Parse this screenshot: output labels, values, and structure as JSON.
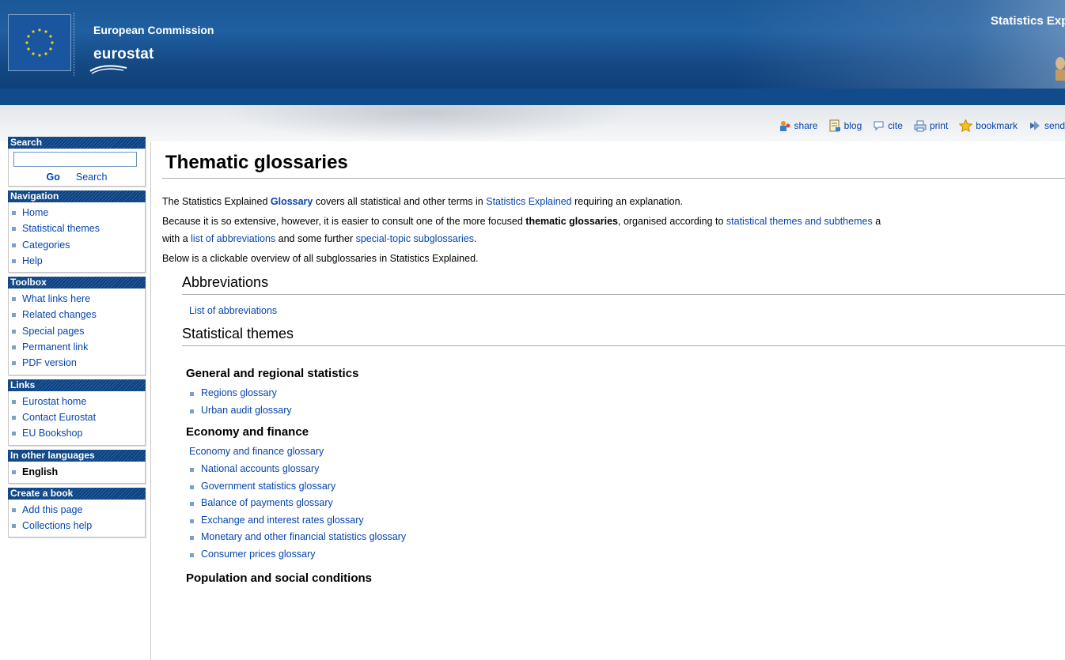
{
  "header": {
    "org_name": "European Commission",
    "logo_text": "eurostat",
    "site_title": "Statistics Explained"
  },
  "share_toolbar": [
    {
      "icon": "share-icon",
      "label": "share"
    },
    {
      "icon": "blog-icon",
      "label": "blog"
    },
    {
      "icon": "cite-icon",
      "label": "cite"
    },
    {
      "icon": "print-icon",
      "label": "print"
    },
    {
      "icon": "bookmark-star-icon",
      "label": "bookmark"
    },
    {
      "icon": "send-icon",
      "label": "send"
    }
  ],
  "sidebar": {
    "search": {
      "title": "Search",
      "input_value": "",
      "go_label": "Go",
      "search_label": "Search"
    },
    "navigation": {
      "title": "Navigation",
      "items": [
        "Home",
        "Statistical themes",
        "Categories",
        "Help"
      ]
    },
    "toolbox": {
      "title": "Toolbox",
      "items": [
        "What links here",
        "Related changes",
        "Special pages",
        "Permanent link",
        "PDF version"
      ]
    },
    "links": {
      "title": "Links",
      "items": [
        "Eurostat home",
        "Contact Eurostat",
        "EU Bookshop"
      ]
    },
    "languages": {
      "title": "In other languages",
      "items": [
        "English"
      ]
    },
    "book": {
      "title": "Create a book",
      "items": [
        "Add this page",
        "Collections help"
      ]
    }
  },
  "main": {
    "page_title": "Thematic glossaries",
    "intro1": {
      "before": "The Statistics Explained ",
      "link1": "Glossary",
      "middle": " covers all statistical and other terms in ",
      "link2": "Statistics Explained",
      "after": " requiring an explanation."
    },
    "intro2": {
      "before": "Because it is so extensive, however, it is easier to consult one of the more focused ",
      "bold": "thematic glossaries",
      "middle": ", organised according to ",
      "link": "statistical themes and subthemes",
      "after": " a"
    },
    "intro3": {
      "before": "with a ",
      "link1": "list of abbreviations",
      "middle": " and some further ",
      "link2": "special-topic subglossaries",
      "after": "."
    },
    "intro4": "Below is a clickable overview of all subglossaries in Statistics Explained.",
    "abbreviations": {
      "heading": "Abbreviations",
      "link": "List of abbreviations"
    },
    "themes": {
      "heading": "Statistical themes",
      "general": {
        "heading": "General and regional statistics",
        "items": [
          "Regions glossary",
          "Urban audit glossary"
        ]
      },
      "economy": {
        "heading": "Economy and finance",
        "main_link": "Economy and finance glossary",
        "items": [
          "National accounts glossary",
          "Government statistics glossary",
          "Balance of payments glossary",
          "Exchange and interest rates glossary",
          "Monetary and other financial statistics glossary",
          "Consumer prices glossary"
        ]
      },
      "population": {
        "heading": "Population and social conditions"
      }
    }
  }
}
